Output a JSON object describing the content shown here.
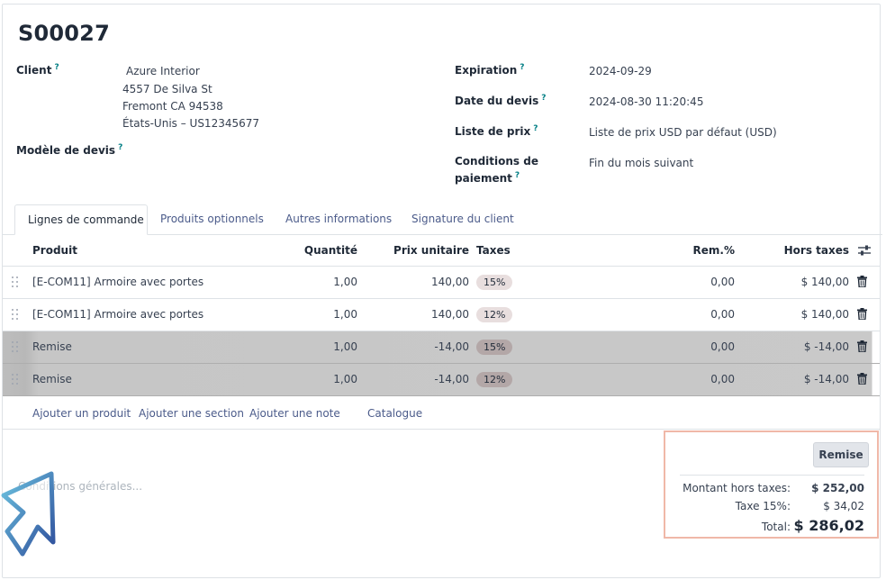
{
  "order": {
    "number": "S00027",
    "customer_label": "Client",
    "customer_lines": [
      "Azure Interior",
      "4557 De Silva St",
      "Fremont CA 94538",
      "États-Unis – US12345677"
    ],
    "template_label": "Modèle de devis",
    "expiration_label": "Expiration",
    "expiration_value": "2024-09-29",
    "quote_date_label": "Date du devis",
    "quote_date_value": "2024-08-30 11:20:45",
    "pricelist_label": "Liste de prix",
    "pricelist_value": "Liste de prix USD par défaut (USD)",
    "payment_terms_label_1": "Conditions de",
    "payment_terms_label_2": "paiement",
    "payment_terms_value": "Fin du mois suivant",
    "help_mark": "?"
  },
  "tabs": [
    "Lignes de commande",
    "Produits optionnels",
    "Autres informations",
    "Signature du client"
  ],
  "table": {
    "headers": {
      "product": "Produit",
      "quantity": "Quantité",
      "unit_price": "Prix unitaire",
      "taxes": "Taxes",
      "discount": "Rem.%",
      "subtotal": "Hors taxes"
    },
    "rows": [
      {
        "product": "[E-COM11] Armoire avec portes",
        "quantity": "1,00",
        "unit_price": "140,00",
        "tax": "15%",
        "discount": "0,00",
        "subtotal": "$ 140,00",
        "highlight": false
      },
      {
        "product": "[E-COM11] Armoire avec portes",
        "quantity": "1,00",
        "unit_price": "140,00",
        "tax": "12%",
        "discount": "0,00",
        "subtotal": "$ 140,00",
        "highlight": false
      },
      {
        "product": "Remise",
        "quantity": "1,00",
        "unit_price": "-14,00",
        "tax": "15%",
        "discount": "0,00",
        "subtotal": "$ -14,00",
        "highlight": true
      },
      {
        "product": "Remise",
        "quantity": "1,00",
        "unit_price": "-14,00",
        "tax": "12%",
        "discount": "0,00",
        "subtotal": "$ -14,00",
        "highlight": true
      }
    ],
    "add_links": {
      "product": "Ajouter un produit",
      "section": "Ajouter une section",
      "note": "Ajouter une note",
      "catalog": "Catalogue"
    }
  },
  "conditions_placeholder": "Conditions générales...",
  "totals": {
    "discount_button": "Remise",
    "untaxed_label": "Montant hors taxes:",
    "untaxed_value": "$ 252,00",
    "tax_label": "Taxe 15%:",
    "tax_value": "$ 34,02",
    "total_label": "Total:",
    "total_value": "$ 286,02"
  },
  "icons": {
    "row_handle": "drag-handle-icon",
    "row_delete": "trash-icon",
    "column_settings": "sliders-icon",
    "pointer": "cursor-arrow-icon"
  },
  "colors": {
    "link": "#4b5b8a",
    "help": "#017e84",
    "highlight_row": "#c6c6c6",
    "totals_border": "#f0b8a8",
    "cursor": "#3a7bbf"
  }
}
